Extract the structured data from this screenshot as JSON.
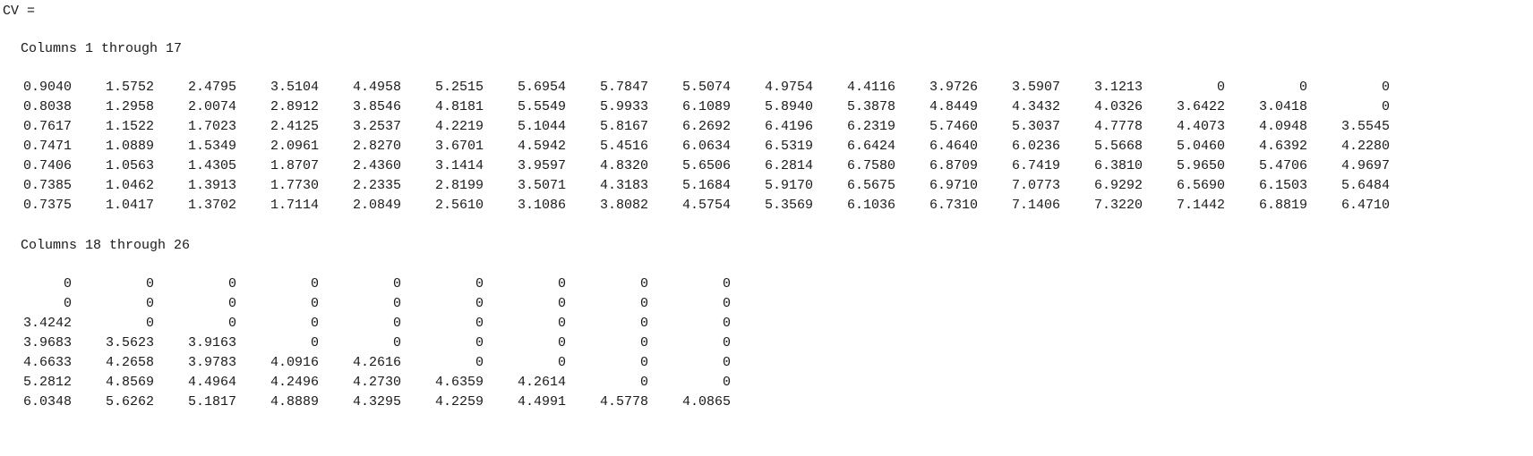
{
  "console": {
    "variable_header": "CV =",
    "blocks": [
      {
        "title": "Columns 1 through 17",
        "rows": [
          [
            "0.9040",
            "1.5752",
            "2.4795",
            "3.5104",
            "4.4958",
            "5.2515",
            "5.6954",
            "5.7847",
            "5.5074",
            "4.9754",
            "4.4116",
            "3.9726",
            "3.5907",
            "3.1213",
            "0",
            "0",
            "0"
          ],
          [
            "0.8038",
            "1.2958",
            "2.0074",
            "2.8912",
            "3.8546",
            "4.8181",
            "5.5549",
            "5.9933",
            "6.1089",
            "5.8940",
            "5.3878",
            "4.8449",
            "4.3432",
            "4.0326",
            "3.6422",
            "3.0418",
            "0"
          ],
          [
            "0.7617",
            "1.1522",
            "1.7023",
            "2.4125",
            "3.2537",
            "4.2219",
            "5.1044",
            "5.8167",
            "6.2692",
            "6.4196",
            "6.2319",
            "5.7460",
            "5.3037",
            "4.7778",
            "4.4073",
            "4.0948",
            "3.5545"
          ],
          [
            "0.7471",
            "1.0889",
            "1.5349",
            "2.0961",
            "2.8270",
            "3.6701",
            "4.5942",
            "5.4516",
            "6.0634",
            "6.5319",
            "6.6424",
            "6.4640",
            "6.0236",
            "5.5668",
            "5.0460",
            "4.6392",
            "4.2280"
          ],
          [
            "0.7406",
            "1.0563",
            "1.4305",
            "1.8707",
            "2.4360",
            "3.1414",
            "3.9597",
            "4.8320",
            "5.6506",
            "6.2814",
            "6.7580",
            "6.8709",
            "6.7419",
            "6.3810",
            "5.9650",
            "5.4706",
            "4.9697"
          ],
          [
            "0.7385",
            "1.0462",
            "1.3913",
            "1.7730",
            "2.2335",
            "2.8199",
            "3.5071",
            "4.3183",
            "5.1684",
            "5.9170",
            "6.5675",
            "6.9710",
            "7.0773",
            "6.9292",
            "6.5690",
            "6.1503",
            "5.6484"
          ],
          [
            "0.7375",
            "1.0417",
            "1.3702",
            "1.7114",
            "2.0849",
            "2.5610",
            "3.1086",
            "3.8082",
            "4.5754",
            "5.3569",
            "6.1036",
            "6.7310",
            "7.1406",
            "7.3220",
            "7.1442",
            "6.8819",
            "6.4710"
          ]
        ]
      },
      {
        "title": "Columns 18 through 26",
        "rows": [
          [
            "0",
            "0",
            "0",
            "0",
            "0",
            "0",
            "0",
            "0",
            "0"
          ],
          [
            "0",
            "0",
            "0",
            "0",
            "0",
            "0",
            "0",
            "0",
            "0"
          ],
          [
            "3.4242",
            "0",
            "0",
            "0",
            "0",
            "0",
            "0",
            "0",
            "0"
          ],
          [
            "3.9683",
            "3.5623",
            "3.9163",
            "0",
            "0",
            "0",
            "0",
            "0",
            "0"
          ],
          [
            "4.6633",
            "4.2658",
            "3.9783",
            "4.0916",
            "4.2616",
            "0",
            "0",
            "0",
            "0"
          ],
          [
            "5.2812",
            "4.8569",
            "4.4964",
            "4.2496",
            "4.2730",
            "4.6359",
            "4.2614",
            "0",
            "0"
          ],
          [
            "6.0348",
            "5.6262",
            "5.1817",
            "4.8889",
            "4.3295",
            "4.2259",
            "4.4991",
            "4.5778",
            "4.0865"
          ]
        ]
      }
    ]
  }
}
